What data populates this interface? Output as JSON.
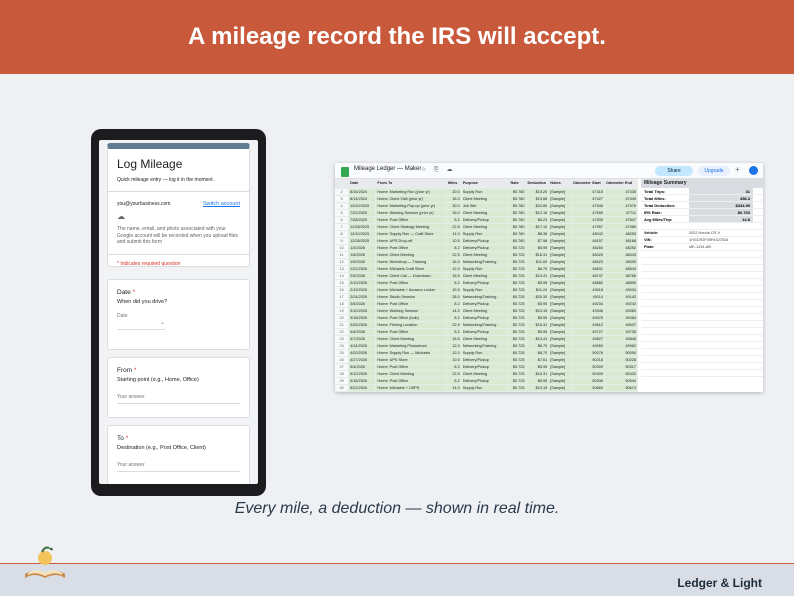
{
  "banner": {
    "title": "A mileage record the IRS will accept."
  },
  "form": {
    "title": "Log Mileage",
    "subtitle": "Quick mileage entry — log it in the moment.",
    "email": "you@yourbusiness.com",
    "switch_account": "Switch account",
    "notice": "The name, email, and photo associated with your Google account will be recorded when you upload files and submit this form",
    "required_note": "* Indicates required question",
    "questions": [
      {
        "label": "Date",
        "help": "When did you drive?",
        "placeholder": "Date"
      },
      {
        "label": "From",
        "help": "Starting point (e.g., Home, Office)",
        "placeholder": "Your answer"
      },
      {
        "label": "To",
        "help": "Destination (e.g., Post Office, Client)",
        "placeholder": "Your answer"
      }
    ]
  },
  "sheet": {
    "name": "Mileage Ledger — Maker",
    "share_label": "Share",
    "upgrade_label": "Upgrade",
    "columns": [
      "",
      "Date",
      "From To",
      "Miles",
      "Purpose",
      "Rate",
      "Deduction",
      "Notes",
      "Odometer Start",
      "Odometer End"
    ],
    "rows": [
      [
        "2",
        "8/16/2024",
        "Home: Marketing Run (prior yr)",
        "20.0",
        "Supply Run",
        "$0.780",
        "$15.20",
        "[Sample]",
        "47315",
        "47335"
      ],
      [
        "3",
        "8/14/2024",
        "Home: Client Visit (prior yr)",
        "18.0",
        "Client Meeting",
        "$0.780",
        "$13.68",
        "[Sample]",
        "47427",
        "47445"
      ],
      [
        "4",
        "10/10/2025",
        "Home: Marketing Pop-up (prior yr)",
        "30.0",
        "Job Site",
        "$0.780",
        "$22.80",
        "[Sample]",
        "47546",
        "47576"
      ],
      [
        "5",
        "7/22/2025",
        "Home: Working Session (prior yr)",
        "16.0",
        "Client Meeting",
        "$0.780",
        "$12.16",
        "[Sample]",
        "47695",
        "47711"
      ],
      [
        "6",
        "7/28/2025",
        "Home: Post Office",
        "8.2",
        "Delivery/Pickup",
        "$0.780",
        "$6.23",
        "[Sample]",
        "47839",
        "47847"
      ],
      [
        "7",
        "12/28/2025",
        "Home: Client Strategy Meeting",
        "22.5",
        "Client Meeting",
        "$0.780",
        "$17.10",
        "[Sample]",
        "47957",
        "47980"
      ],
      [
        "8",
        "12/10/2025",
        "Home: Supply Run — Craft Store",
        "11.0",
        "Supply Run",
        "$0.780",
        "$8.36",
        "[Sample]",
        "48042",
        "48053"
      ],
      [
        "9",
        "12/28/2025",
        "Home: UPS Drop-off",
        "10.5",
        "Delivery/Pickup",
        "$0.780",
        "$7.98",
        "[Sample]",
        "48157",
        "48168"
      ],
      [
        "10",
        "1/3/2026",
        "Home: Post Office",
        "8.2",
        "Delivery/Pickup",
        "$0.725",
        "$5.95",
        "[Sample]",
        "48284",
        "48292"
      ],
      [
        "11",
        "1/6/2026",
        "Home: Client Meeting",
        "22.5",
        "Client Meeting",
        "$0.725",
        "$16.31",
        "[Sample]",
        "48420",
        "48443"
      ],
      [
        "12",
        "1/9/2026",
        "Home: Workshop — Training",
        "16.0",
        "Networking/Training",
        "$0.725",
        "$11.60",
        "[Sample]",
        "48523",
        "48539"
      ],
      [
        "13",
        "1/22/2026",
        "Home: Michaels Craft Store",
        "12.0",
        "Supply Run",
        "$0.725",
        "$8.70",
        "[Sample]",
        "48631",
        "48643"
      ],
      [
        "14",
        "2/5/2026",
        "Home: Client Call — Downtown",
        "18.5",
        "Client Meeting",
        "$0.725",
        "$13.41",
        "[Sample]",
        "48747",
        "48766"
      ],
      [
        "15",
        "2/12/2026",
        "Home: Post Office",
        "8.2",
        "Delivery/Pickup",
        "$0.725",
        "$5.95",
        "[Sample]",
        "48882",
        "48890"
      ],
      [
        "16",
        "2/19/2026",
        "Home: Michaels + Amazon Locker",
        "15.5",
        "Supply Run",
        "$0.725",
        "$11.24",
        "[Sample]",
        "49018",
        "49034"
      ],
      [
        "17",
        "2/24/2026",
        "Home: Studio Session",
        "28.0",
        "Networking/Training",
        "$0.725",
        "$20.30",
        "[Sample]",
        "49114",
        "49142"
      ],
      [
        "18",
        "3/6/2026",
        "Home: Post Office",
        "8.2",
        "Delivery/Pickup",
        "$0.725",
        "$5.95",
        "[Sample]",
        "49234",
        "49242"
      ],
      [
        "19",
        "3/10/2026",
        "Home: Working Session",
        "14.0",
        "Client Meeting",
        "$0.725",
        "$10.15",
        "[Sample]",
        "49346",
        "49360"
      ],
      [
        "20",
        "3/18/2026",
        "Home: Post Office (bulk)",
        "8.2",
        "Delivery/Pickup",
        "$0.725",
        "$5.95",
        "[Sample]",
        "49476",
        "49484"
      ],
      [
        "21",
        "3/25/2026",
        "Home: Filming Location",
        "22.5",
        "Networking/Training",
        "$0.725",
        "$16.31",
        "[Sample]",
        "49612",
        "49637"
      ],
      [
        "22",
        "4/4/2026",
        "Home: Post Office",
        "8.2",
        "Delivery/Pickup",
        "$0.725",
        "$5.95",
        "[Sample]",
        "49727",
        "49735"
      ],
      [
        "23",
        "4/7/2026",
        "Home: Client Meeting",
        "18.5",
        "Client Meeting",
        "$0.725",
        "$13.41",
        "[Sample]",
        "49827",
        "49846"
      ],
      [
        "24",
        "4/14/2026",
        "Home: Marketing Photoshoot",
        "12.0",
        "Networking/Training",
        "$0.725",
        "$8.70",
        "[Sample]",
        "49950",
        "49962"
      ],
      [
        "25",
        "4/20/2026",
        "Home: Supply Run — Michaels",
        "12.0",
        "Supply Run",
        "$0.725",
        "$8.70",
        "[Sample]",
        "50078",
        "50090"
      ],
      [
        "26",
        "4/27/2026",
        "Home: UPS Store",
        "10.5",
        "Delivery/Pickup",
        "$0.725",
        "$7.61",
        "[Sample]",
        "50218",
        "50228"
      ],
      [
        "27",
        "5/4/2026",
        "Home: Post Office",
        "8.2",
        "Delivery/Pickup",
        "$0.725",
        "$5.95",
        "[Sample]",
        "50309",
        "50317"
      ],
      [
        "28",
        "5/12/2026",
        "Home: Client Meeting",
        "22.5",
        "Client Meeting",
        "$0.725",
        "$16.31",
        "[Sample]",
        "50409",
        "50432"
      ],
      [
        "29",
        "5/18/2026",
        "Home: Post Office",
        "8.2",
        "Delivery/Pickup",
        "$0.725",
        "$5.95",
        "[Sample]",
        "50536",
        "50544"
      ],
      [
        "30",
        "5/22/2026",
        "Home: Michaels + USPS",
        "14.0",
        "Supply Run",
        "$0.725",
        "$10.15",
        "[Sample]",
        "50660",
        "50674"
      ],
      [
        "31",
        "6/3/2026",
        "Home: Post Office",
        "8.2",
        "Delivery/Pickup",
        "$0.725",
        "$5.95",
        "[Sample]",
        "50802",
        "50810"
      ]
    ],
    "summary": {
      "title": "Mileage Summary",
      "items": [
        {
          "label": "Total Trips:",
          "value": "31"
        },
        {
          "label": "Total Miles:",
          "value": "458.3"
        },
        {
          "label": "Total Deduction:",
          "value": "$334.99"
        },
        {
          "label": "IRS Rate:",
          "value": "$0.760"
        },
        {
          "label": "Avg Miles/Trip:",
          "value": "14.8"
        }
      ],
      "vehicle": [
        {
          "label": "Vehicle:",
          "value": "2022 Honda CR-V"
        },
        {
          "label": "VIN:",
          "value": "1HGCR2F39FA027534"
        },
        {
          "label": "Plate:",
          "value": "ME-1234-AB"
        }
      ]
    }
  },
  "caption": "Every mile, a deduction — shown in real time.",
  "footer": {
    "brand": "Ledger & Light"
  },
  "colors": {
    "banner": "#c8593b",
    "accent_green": "#d9ead3",
    "footer": "#d9dee6"
  }
}
